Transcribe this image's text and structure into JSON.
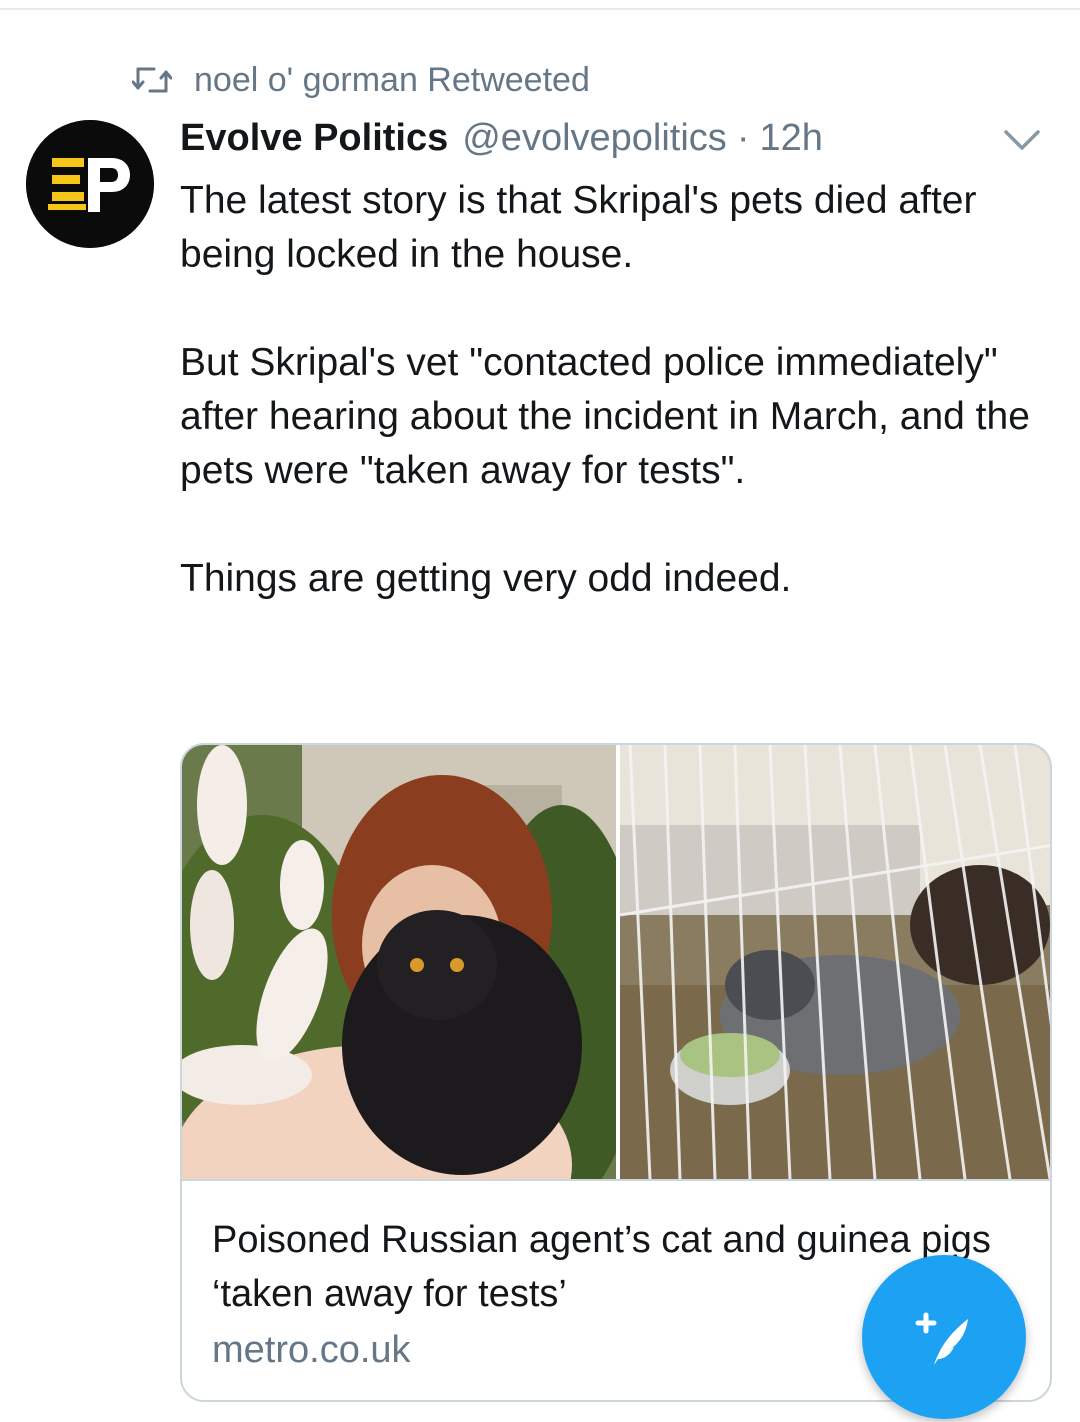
{
  "retweet": {
    "icon": "retweet-icon",
    "text": "noel o' gorman Retweeted"
  },
  "author": {
    "avatar": "evolve-politics-logo",
    "avatar_text": "EP",
    "display_name": "Evolve Politics",
    "handle": "@evolvepolitics",
    "separator": "·",
    "time": "12h",
    "menu_icon": "chevron-down-icon"
  },
  "tweet": {
    "paragraphs": [
      "The latest story is that Skripal's pets died after being locked in the house.",
      "But Skripal's vet \"contacted police immediately\" after hearing about the incident in March, and the pets were \"taken away for tests\".",
      "Things are getting very odd indeed."
    ]
  },
  "card": {
    "title": "Poisoned Russian agent’s cat and guinea pigs ‘taken away for tests’",
    "domain": "metro.co.uk"
  },
  "fab": {
    "icon": "compose-tweet-icon"
  },
  "colors": {
    "accent": "#1da1f2",
    "text": "#14171a",
    "secondary": "#657786",
    "border": "#ccd6dd"
  }
}
